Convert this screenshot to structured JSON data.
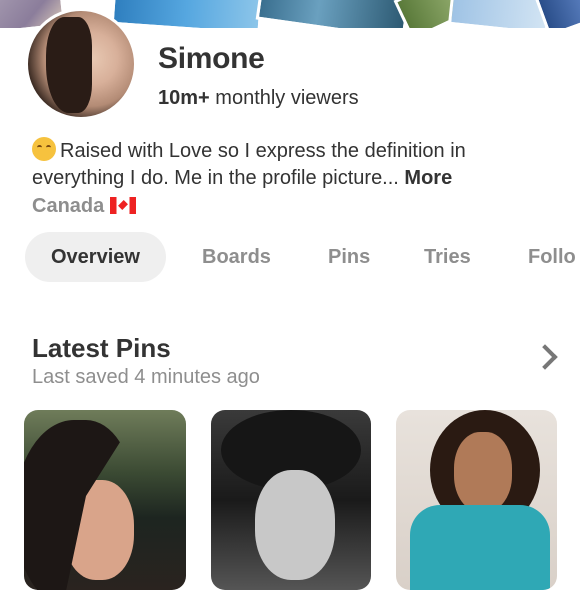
{
  "profile": {
    "name": "Simone",
    "viewers_count": "10m+",
    "viewers_label": "monthly viewers",
    "bio_emoji": "hugging-face-emoji",
    "bio_text": "Raised with Love so I express the definition in everything I do. Me in the profile picture...",
    "bio_more": "More",
    "location": "Canada",
    "location_flag": "canada-flag"
  },
  "tabs": [
    {
      "label": "Overview",
      "active": true
    },
    {
      "label": "Boards",
      "active": false
    },
    {
      "label": "Pins",
      "active": false
    },
    {
      "label": "Tries",
      "active": false
    },
    {
      "label": "Follo",
      "active": false
    }
  ],
  "latest": {
    "title": "Latest Pins",
    "subtitle": "Last saved 4 minutes ago"
  },
  "colors": {
    "text": "#333333",
    "muted": "#8e8e8e",
    "active_tab_bg": "#efefef"
  }
}
